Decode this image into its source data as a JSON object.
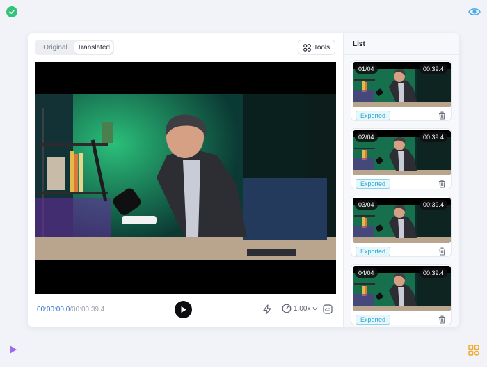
{
  "panel": {
    "tabs": [
      {
        "label": "Original",
        "active": false
      },
      {
        "label": "Translated",
        "active": true
      }
    ],
    "tools_label": "Tools"
  },
  "player": {
    "current_time": "00:00:00.0",
    "total_time": "/00:00:39.4",
    "speed": "1.00x"
  },
  "list": {
    "title": "List",
    "items": [
      {
        "index": "01/04",
        "duration": "00:39.4",
        "status": "Exported"
      },
      {
        "index": "02/04",
        "duration": "00:39.4",
        "status": "Exported"
      },
      {
        "index": "03/04",
        "duration": "00:39.4",
        "status": "Exported"
      },
      {
        "index": "04/04",
        "duration": "00:39.4",
        "status": "Exported"
      }
    ]
  },
  "colors": {
    "accent_blue": "#2e6fd9",
    "exported_text": "#2ba6cf",
    "check_green": "#34c37a",
    "play_purple": "#9b6cf0",
    "grid_orange": "#f0a928"
  }
}
